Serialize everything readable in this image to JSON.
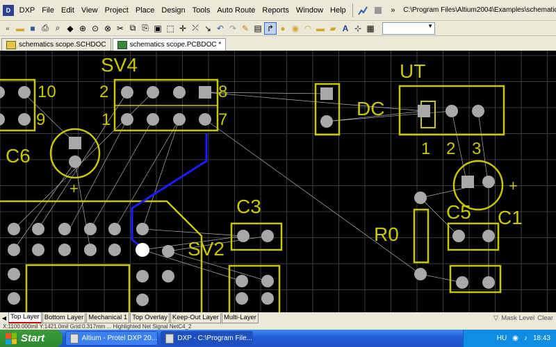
{
  "menu": {
    "app_label": "DXP",
    "items": [
      "File",
      "Edit",
      "View",
      "Project",
      "Place",
      "Design",
      "Tools",
      "Auto Route",
      "Reports",
      "Window",
      "Help"
    ],
    "path": "C:\\Program Files\\Altium2004\\Examples\\schematics sco"
  },
  "toolbar": {
    "combo_value": ""
  },
  "doc_tabs": [
    {
      "label": "schematics scope.SCHDOC",
      "icon": "schematic-doc-icon"
    },
    {
      "label": "schematics scope.PCBDOC *",
      "icon": "pcb-doc-icon"
    }
  ],
  "components": {
    "sv4": "SV4",
    "ut": "UT",
    "c6": "C6",
    "c3": "C3",
    "c5": "C5",
    "c1": "C1",
    "r0": "R0",
    "sv2": "SV2",
    "dc": "DC",
    "n10": "10",
    "n9": "9",
    "n2": "2",
    "n1": "1",
    "n8": "8",
    "n7": "7",
    "ut1": "1",
    "ut2": "2",
    "ut3": "3",
    "plus": "+"
  },
  "layer_tabs": [
    "Top Layer",
    "Bottom Layer",
    "Mechanical 1",
    "Top Overlay",
    "Keep-Out Layer",
    "Multi-Layer"
  ],
  "layer_right": {
    "mask": "Mask Level",
    "clear": "Clear"
  },
  "status_text": "X:1100.000mil Y:1421.0mil    Grid:0.317mm    ...    Highlighted Net Signal    NetC4_2",
  "taskbar": {
    "start": "Start",
    "tasks": [
      "Altium - Protel DXP 20...",
      "DXP - C:\\Program File..."
    ],
    "lang": "HU",
    "time": "18:43"
  },
  "colors": {
    "pad": "#a8a8a8",
    "silk": "#c8c800",
    "trace": "#1c1cff",
    "canvas": "#000000",
    "grid": "#404040"
  }
}
